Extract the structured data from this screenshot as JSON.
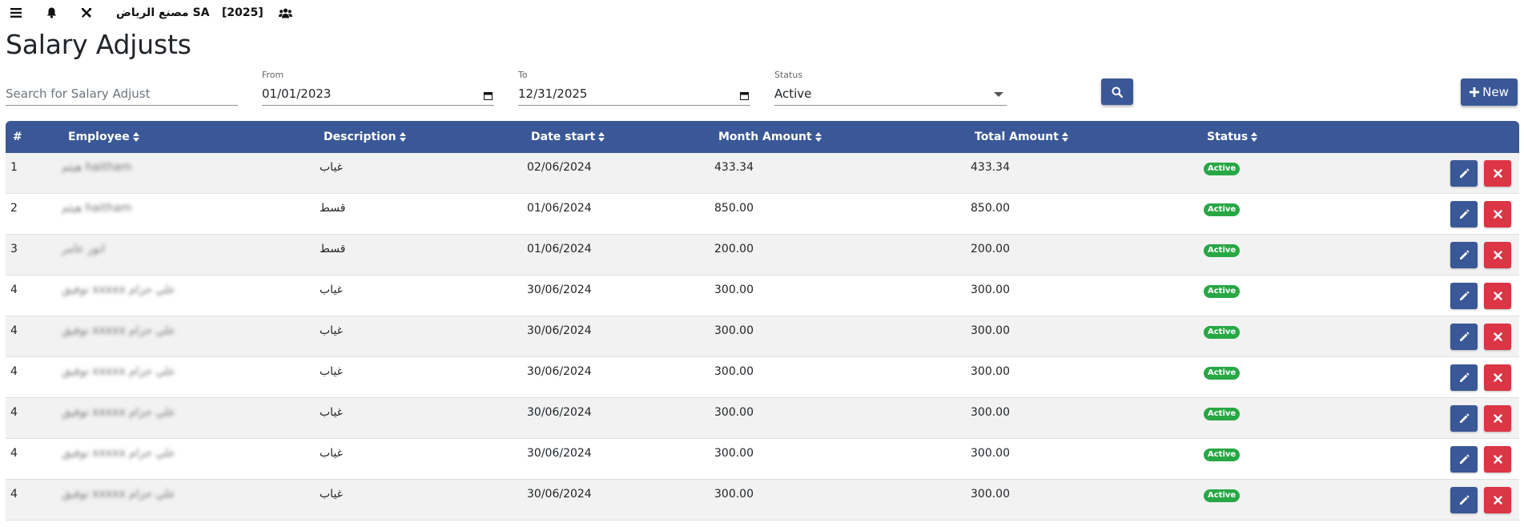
{
  "topbar": {
    "company": "مصنع الرياض SA",
    "year": "[2025]"
  },
  "page": {
    "title": "Salary Adjusts"
  },
  "filters": {
    "search_placeholder": "Search for Salary Adjust",
    "from_label": "From",
    "from_value": "01/01/2023",
    "to_label": "To",
    "to_value": "12/31/2025",
    "status_label": "Status",
    "status_value": "Active"
  },
  "buttons": {
    "new_label": "New"
  },
  "table": {
    "columns": [
      "#",
      "Employee",
      "Description",
      "Date start",
      "Month Amount",
      "Total Amount",
      "Status"
    ],
    "rows": [
      {
        "num": "1",
        "employee": "هيثم haitham",
        "description": "غياب",
        "date_start": "02/06/2024",
        "month_amount": "433.34",
        "total_amount": "433.34",
        "status": "Active"
      },
      {
        "num": "2",
        "employee": "هيثم haitham",
        "description": "قسط",
        "date_start": "01/06/2024",
        "month_amount": "850.00",
        "total_amount": "850.00",
        "status": "Active"
      },
      {
        "num": "3",
        "employee": "انور عامر",
        "description": "قسط",
        "date_start": "01/06/2024",
        "month_amount": "200.00",
        "total_amount": "200.00",
        "status": "Active"
      },
      {
        "num": "4",
        "employee": "توفيق xxxxx علي حزام",
        "description": "غياب",
        "date_start": "30/06/2024",
        "month_amount": "300.00",
        "total_amount": "300.00",
        "status": "Active"
      },
      {
        "num": "4",
        "employee": "توفيق xxxxx علي حزام",
        "description": "غياب",
        "date_start": "30/06/2024",
        "month_amount": "300.00",
        "total_amount": "300.00",
        "status": "Active"
      },
      {
        "num": "4",
        "employee": "توفيق xxxxx علي حزام",
        "description": "غياب",
        "date_start": "30/06/2024",
        "month_amount": "300.00",
        "total_amount": "300.00",
        "status": "Active"
      },
      {
        "num": "4",
        "employee": "توفيق xxxxx علي حزام",
        "description": "غياب",
        "date_start": "30/06/2024",
        "month_amount": "300.00",
        "total_amount": "300.00",
        "status": "Active"
      },
      {
        "num": "4",
        "employee": "توفيق xxxxx علي حزام",
        "description": "غياب",
        "date_start": "30/06/2024",
        "month_amount": "300.00",
        "total_amount": "300.00",
        "status": "Active"
      },
      {
        "num": "4",
        "employee": "توفيق xxxxx علي حزام",
        "description": "غياب",
        "date_start": "30/06/2024",
        "month_amount": "300.00",
        "total_amount": "300.00",
        "status": "Active"
      }
    ]
  },
  "colors": {
    "primary": "#3a5897",
    "danger": "#dc3545",
    "success": "#28a745",
    "row_stripe": "#f2f2f2"
  },
  "icons": {
    "topbar": [
      "menu-icon",
      "bell-icon",
      "tools-icon",
      "users-icon"
    ],
    "search_button": "search-icon",
    "new_button": "plus-icon",
    "row_actions": [
      "pencil-icon",
      "close-icon"
    ]
  }
}
